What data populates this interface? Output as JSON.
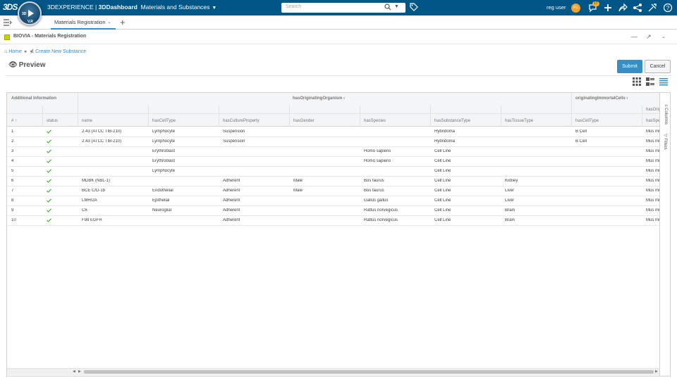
{
  "topbar": {
    "logo": "3DS",
    "brand_prefix": "3DEXPERIENCE | ",
    "brand_app": "3DDashboard",
    "dashboard_name": "Materials and Substances",
    "compass_labels": [
      "3D",
      "V,R"
    ],
    "search_placeholder": "Search",
    "user_name": "reg user",
    "avatar_initials": "RU",
    "notification_count": "17"
  },
  "tabs": {
    "active_label": "Materials Registration"
  },
  "panel": {
    "title": "BIOVIA - Materials Registration"
  },
  "breadcrumb": {
    "home": "Home",
    "current": "Create New Substance"
  },
  "page": {
    "title": "Preview",
    "submit_label": "Submit",
    "cancel_label": "Cancel"
  },
  "grid": {
    "groups": {
      "additional": "Additional Information",
      "organism": "hasOriginatingOrganism",
      "cells": "originatingImmortalCells",
      "cells_sub": "hasOrig"
    },
    "columns": [
      "#",
      "status",
      "name",
      "hasCellType",
      "hasCultureProperty",
      "hasGender",
      "hasSpecies",
      "hasSubstanceType",
      "hasTissueType",
      "hasCellType",
      "hasSpe"
    ],
    "rows": [
      {
        "n": "1",
        "name": "2.43 (ATCC TIB-210)",
        "celltype": "Lymphocyte",
        "culture": "Suspension",
        "gender": "",
        "species": "",
        "substance": "Hybridoma",
        "tissue": "",
        "cells_celltype": "B Cell",
        "spe": "Mus mu"
      },
      {
        "n": "2",
        "name": "2.43 (ATCC TIB-210)",
        "celltype": "Lymphocyte",
        "culture": "Suspension",
        "gender": "",
        "species": "",
        "substance": "Hybridoma",
        "tissue": "",
        "cells_celltype": "B Cell",
        "spe": "Mus mu"
      },
      {
        "n": "3",
        "name": "",
        "celltype": "Erythroblast",
        "culture": "",
        "gender": "",
        "species": "Homo sapiens",
        "substance": "Cell Line",
        "tissue": "",
        "cells_celltype": "",
        "spe": "Mus mu"
      },
      {
        "n": "4",
        "name": "",
        "celltype": "Erythroblast",
        "culture": "",
        "gender": "",
        "species": "Homo sapiens",
        "substance": "Cell Line",
        "tissue": "",
        "cells_celltype": "",
        "spe": "Mus mu"
      },
      {
        "n": "5",
        "name": "",
        "celltype": "Lymphocyte",
        "culture": "",
        "gender": "",
        "species": "",
        "substance": "Cell Line",
        "tissue": "",
        "cells_celltype": "",
        "spe": "Mus mu"
      },
      {
        "n": "6",
        "name": "MDBK (NBL-1)",
        "celltype": "",
        "culture": "Adherent",
        "gender": "Male",
        "species": "Bos taurus",
        "substance": "Cell Line",
        "tissue": "Kidney",
        "cells_celltype": "",
        "spe": "Mus mu"
      },
      {
        "n": "7",
        "name": "BCE C/D-1b",
        "celltype": "Endothelial",
        "culture": "Adherent",
        "gender": "Male",
        "species": "Bos taurus",
        "substance": "Cell Line",
        "tissue": "Liver",
        "cells_celltype": "",
        "spe": "Mus mu"
      },
      {
        "n": "8",
        "name": "LMH/2A",
        "celltype": "Epithelial",
        "culture": "Adherent",
        "gender": "",
        "species": "Gallus gallus",
        "substance": "Cell Line",
        "tissue": "Liver",
        "cells_celltype": "",
        "spe": "Mus mu"
      },
      {
        "n": "9",
        "name": "C6",
        "celltype": "Neuroglial",
        "culture": "Adherent",
        "gender": "",
        "species": "Rattus norvegicus",
        "substance": "Cell Line",
        "tissue": "Brain",
        "cells_celltype": "",
        "spe": "Mus mu"
      },
      {
        "n": "10",
        "name": "F98 EGFR",
        "celltype": "",
        "culture": "Adherent",
        "gender": "",
        "species": "Rattus norvegicus",
        "substance": "Cell Line",
        "tissue": "Brain",
        "cells_celltype": "",
        "spe": "Mus mu"
      }
    ],
    "side_tabs": [
      "Columns",
      "Filters"
    ]
  },
  "colors": {
    "topbar": "#005686",
    "accent": "#368ec4",
    "status_ok": "#57b847"
  },
  "icons": [
    "search-icon",
    "tag-icon",
    "notifications-icon",
    "plus-icon",
    "share-icon",
    "network-icon",
    "tools-icon",
    "help-icon",
    "menu-icon",
    "grid-view-icon",
    "tile-view-icon",
    "list-view-icon",
    "eye-icon",
    "home-icon",
    "check-icon"
  ]
}
